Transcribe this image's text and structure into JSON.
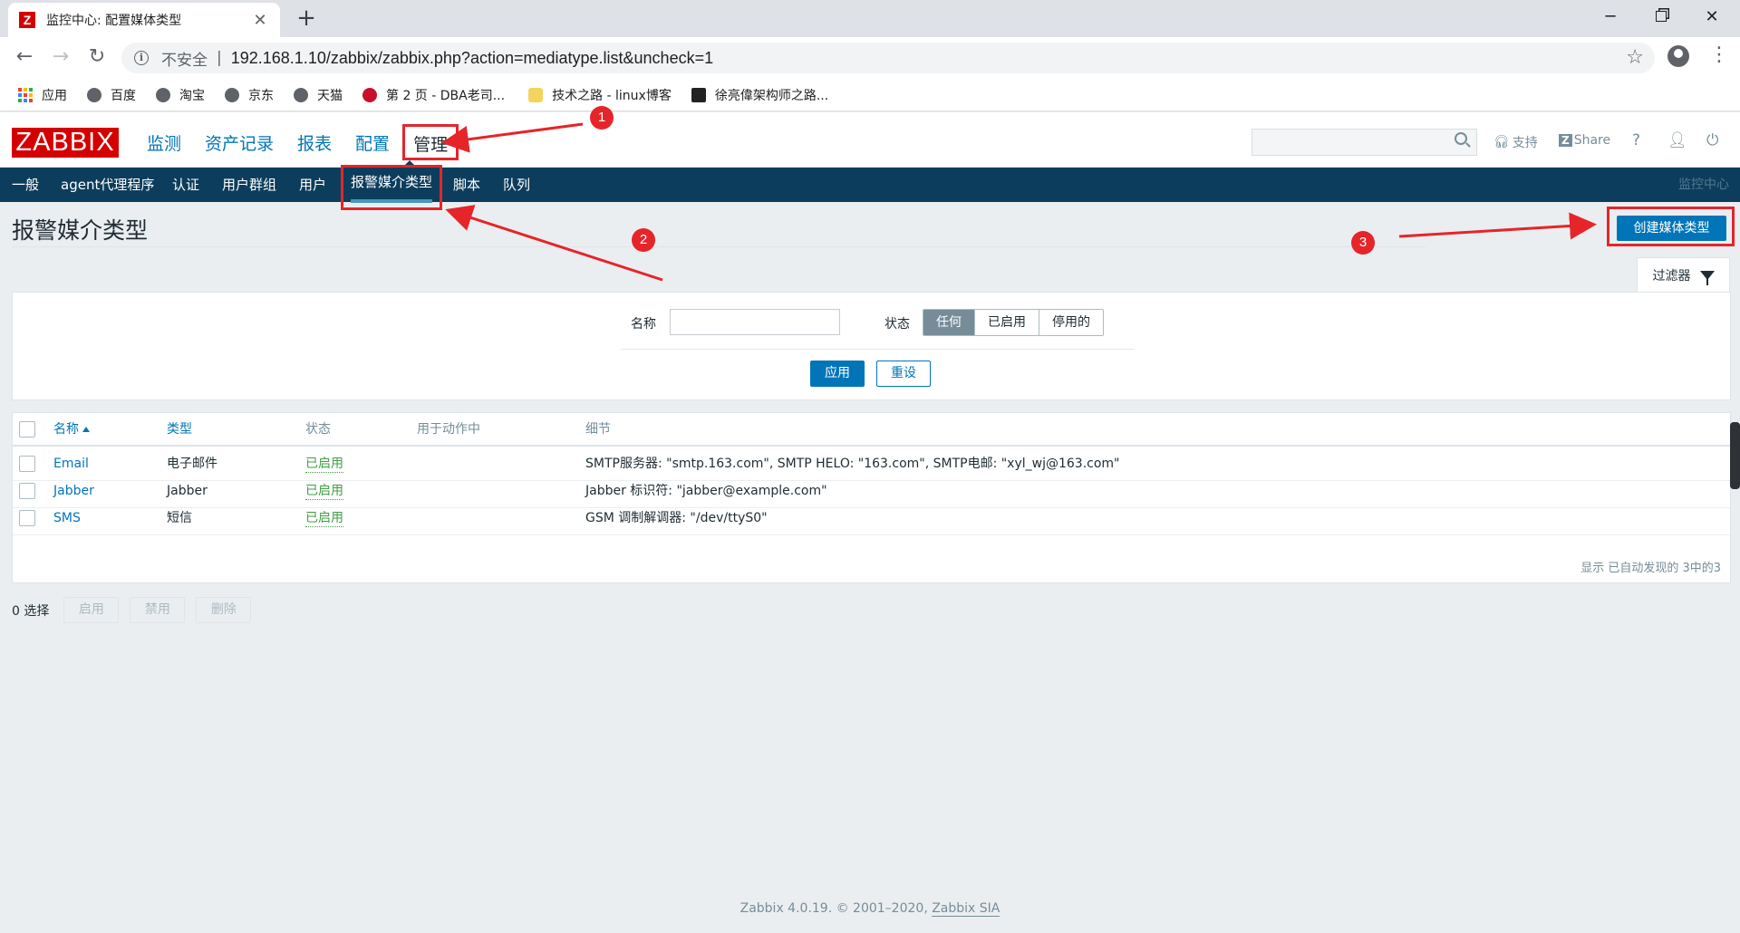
{
  "browser": {
    "tab_title": "监控中心: 配置媒体类型",
    "tab_icon": "Z",
    "insecure_label": "不安全",
    "url": "192.168.1.10/zabbix/zabbix.php?action=mediatype.list&uncheck=1",
    "bookmarks": [
      {
        "label": "应用",
        "icon": "apps-icon"
      },
      {
        "label": "百度",
        "icon": "globe-icon"
      },
      {
        "label": "淘宝",
        "icon": "globe-icon"
      },
      {
        "label": "京东",
        "icon": "globe-icon"
      },
      {
        "label": "天猫",
        "icon": "globe-icon"
      },
      {
        "label": "第 2 页 - DBA老司...",
        "icon": "dba-icon"
      },
      {
        "label": "技术之路 - linux博客",
        "icon": "bulb-icon"
      },
      {
        "label": "徐亮偉架构师之路...",
        "icon": "blog-icon"
      }
    ]
  },
  "header": {
    "logo": "ZABBIX",
    "menu": [
      "监测",
      "资产记录",
      "报表",
      "配置",
      "管理"
    ],
    "active_menu": "管理",
    "support": "支持",
    "share": "Share",
    "help": "?"
  },
  "submenu": {
    "items": [
      "一般",
      "agent代理程序",
      "认证",
      "用户群组",
      "用户",
      "报警媒介类型",
      "脚本",
      "队列"
    ],
    "active": "报警媒介类型",
    "right_label": "监控中心"
  },
  "page": {
    "title": "报警媒介类型",
    "create_button": "创建媒体类型",
    "filter_tab": "过滤器"
  },
  "filter": {
    "name_label": "名称",
    "name_value": "",
    "status_label": "状态",
    "status_options": [
      "任何",
      "已启用",
      "停用的"
    ],
    "status_selected": "任何",
    "apply": "应用",
    "reset": "重设"
  },
  "table": {
    "headers": {
      "name": "名称",
      "type": "类型",
      "status": "状态",
      "used_in_actions": "用于动作中",
      "details": "细节"
    },
    "rows": [
      {
        "name": "Email",
        "type": "电子邮件",
        "status": "已启用",
        "used": "",
        "details": "SMTP服务器: \"smtp.163.com\", SMTP HELO: \"163.com\", SMTP电邮: \"xyl_wj@163.com\""
      },
      {
        "name": "Jabber",
        "type": "Jabber",
        "status": "已启用",
        "used": "",
        "details": "Jabber 标识符: \"jabber@example.com\""
      },
      {
        "name": "SMS",
        "type": "短信",
        "status": "已启用",
        "used": "",
        "details": "GSM 调制解调器: \"/dev/ttyS0\""
      }
    ],
    "footer": "显示 已自动发现的 3中的3"
  },
  "actions": {
    "selected": "0 选择",
    "enable": "启用",
    "disable": "禁用",
    "delete": "删除"
  },
  "footer": {
    "text": "Zabbix 4.0.19. © 2001–2020, ",
    "link": "Zabbix SIA"
  },
  "annotations": [
    "1",
    "2",
    "3"
  ],
  "colors": {
    "zabbix_red": "#d40000",
    "nav_dark": "#0d3d5c",
    "link_blue": "#0275b8",
    "enabled_green": "#429e47",
    "annotation_red": "#e5252a"
  }
}
